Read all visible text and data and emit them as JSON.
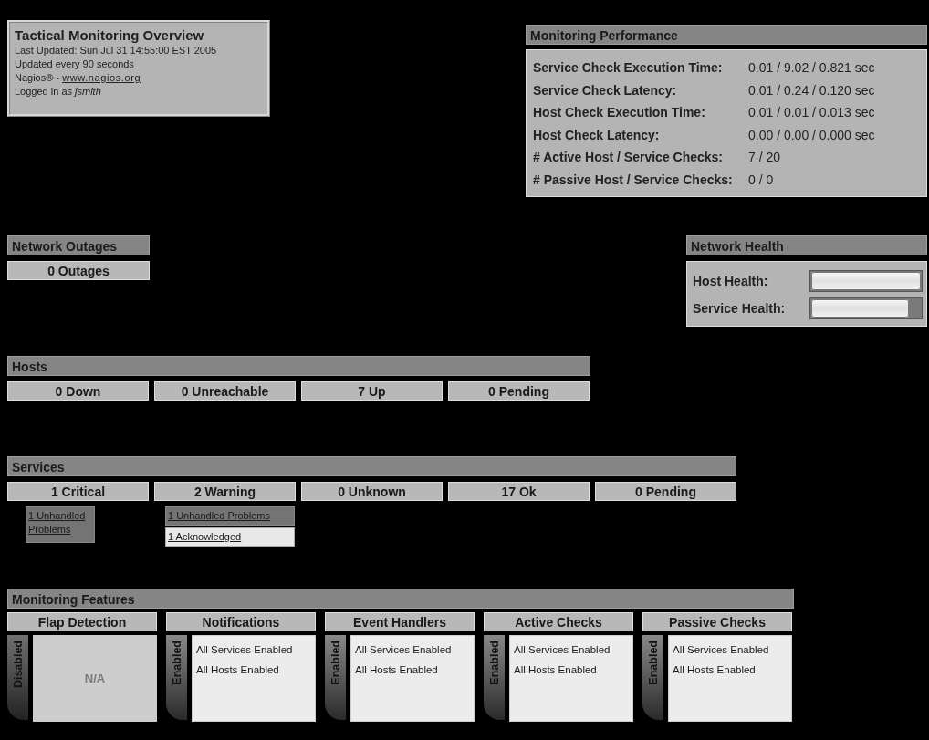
{
  "overview": {
    "title": "Tactical Monitoring Overview",
    "last_updated": "Last Updated: Sun Jul 31 14:55:00 EST 2005",
    "refresh": "Updated every 90 seconds",
    "credit": "Nagios® - ",
    "credit_link": "www.nagios.org",
    "login": "Logged in as *jsmith*"
  },
  "performance": {
    "title": "Monitoring Performance",
    "rows": [
      {
        "label": "Service Check Execution Time:",
        "value": "0.01 / 9.02 / 0.821 sec"
      },
      {
        "label": "Service Check Latency:",
        "value": "0.01 / 0.24 / 0.120 sec"
      },
      {
        "label": "Host Check Execution Time:",
        "value": "0.01 / 0.01 / 0.013 sec"
      },
      {
        "label": "Host Check Latency:",
        "value": "0.00 / 0.00 / 0.000 sec"
      },
      {
        "label": "# Active Host / Service Checks:",
        "value": "7 / 20"
      },
      {
        "label": "# Passive Host / Service Checks:",
        "value": "0 / 0"
      }
    ]
  },
  "outages": {
    "title": "Network Outages",
    "summary": "0 Outages"
  },
  "health": {
    "title": "Network Health",
    "meters": [
      {
        "label": "Host Health:",
        "level": 1.0
      },
      {
        "label": "Service Health:",
        "level": 0.89
      }
    ]
  },
  "hosts": {
    "title": "Hosts",
    "cells": [
      {
        "label": "0 Down"
      },
      {
        "label": "0 Unreachable"
      },
      {
        "label": "7 Up"
      },
      {
        "label": "0 Pending"
      }
    ]
  },
  "services": {
    "title": "Services",
    "cells": [
      {
        "label": "1 Critical",
        "links": [
          {
            "kind": "unhandled",
            "text": "1 Unhandled Problems"
          }
        ]
      },
      {
        "label": "2 Warning",
        "links": [
          {
            "kind": "unhandled",
            "text": "1 Unhandled Problems"
          },
          {
            "kind": "acknowledged",
            "text": "1 Acknowledged"
          }
        ]
      },
      {
        "label": "0 Unknown"
      },
      {
        "label": "17 Ok"
      },
      {
        "label": "0 Pending"
      }
    ]
  },
  "features": {
    "title": "Monitoring Features",
    "columns": [
      {
        "title": "Flap Detection",
        "enabled": false,
        "status": "Disabled",
        "body": [
          "N/A"
        ]
      },
      {
        "title": "Notifications",
        "enabled": true,
        "status": "Enabled",
        "body": [
          "All Services Enabled",
          "All Hosts Enabled"
        ]
      },
      {
        "title": "Event Handlers",
        "enabled": true,
        "status": "Enabled",
        "body": [
          "All Services Enabled",
          "All Hosts Enabled"
        ]
      },
      {
        "title": "Active Checks",
        "enabled": true,
        "status": "Enabled",
        "body": [
          "All Services Enabled",
          "All Hosts Enabled"
        ]
      },
      {
        "title": "Passive Checks",
        "enabled": true,
        "status": "Enabled",
        "body": [
          "All Services Enabled",
          "All Hosts Enabled"
        ]
      }
    ]
  }
}
